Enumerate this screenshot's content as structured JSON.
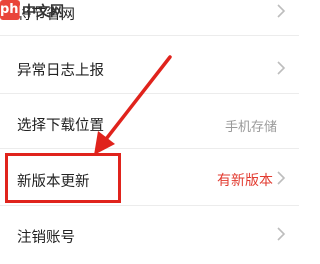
{
  "watermark": {
    "badge": "php",
    "text": "中文网"
  },
  "items": [
    {
      "label": "将节省网",
      "value": "",
      "chevron": true
    },
    {
      "label": "异常日志上报",
      "value": "",
      "chevron": true
    },
    {
      "label": "选择下载位置",
      "value": "手机存储",
      "chevron": false
    },
    {
      "label": "新版本更新",
      "value": "有新版本",
      "chevron": true
    },
    {
      "label": "注销账号",
      "value": "",
      "chevron": true
    }
  ],
  "colors": {
    "accent_red": "#e0231c",
    "value_red": "#e23b30",
    "value_gray": "#9a9a9a",
    "chevron": "#bdbdbd"
  }
}
